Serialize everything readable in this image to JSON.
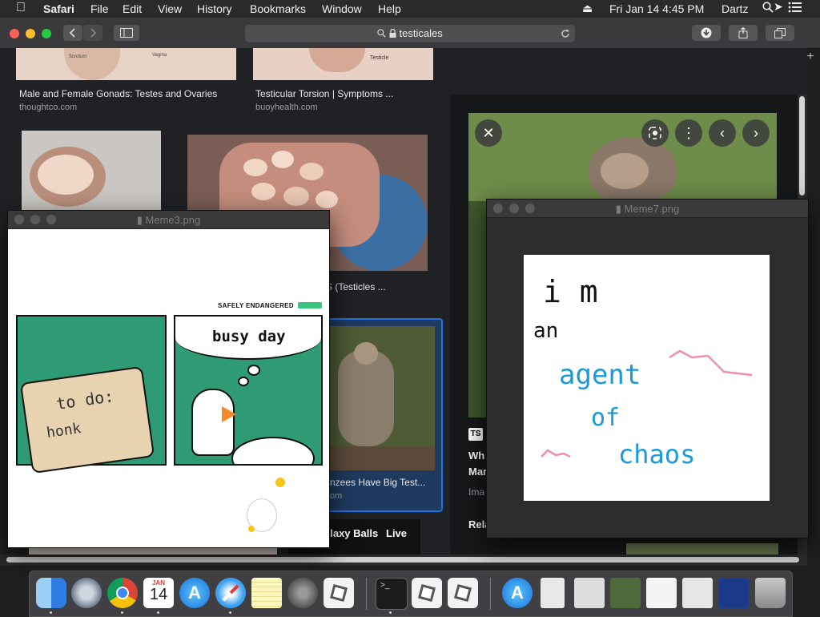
{
  "menubar": {
    "app": "Safari",
    "items": [
      "File",
      "Edit",
      "View",
      "History",
      "Bookmarks",
      "Window",
      "Help"
    ],
    "clock": "Fri Jan 14  4:45 PM",
    "user": "Dartz"
  },
  "toolbar": {
    "url": "testicales",
    "lock_icon": "lock-icon"
  },
  "results": {
    "r1_caption": "Male and Female Gonads: Testes and Ovaries",
    "r1_source": "thoughtco.com",
    "r1_label_a": "Scrotum",
    "r1_label_b": "Vagina",
    "r2_caption": "Testicular Torsion | Symptoms ...",
    "r2_source": "buoyhealth.com",
    "r2_label": "Testicle",
    "r3_caption": "S (Testicles ...",
    "r4_caption": "nzees Have Big Test...",
    "r4_source": "om",
    "r5_caption": "alaxy Balls",
    "r5_live": "Live"
  },
  "detail": {
    "badge": "TS",
    "title_a": "Wh",
    "title_b": "Mar",
    "source": "Ima",
    "related": "Rela"
  },
  "meme3": {
    "title": "Meme3.png",
    "brand": "SAFELY ENDANGERED",
    "panel1_line1": "to do:",
    "panel1_line2": "honk",
    "panel2_text": "busy day"
  },
  "meme7": {
    "title": "Meme7.png",
    "line1": "i m",
    "line2": "an",
    "line3": "agent",
    "line4": "of",
    "line5": "chaos"
  },
  "dock": {
    "calendar_month": "JAN",
    "calendar_day": "14"
  }
}
